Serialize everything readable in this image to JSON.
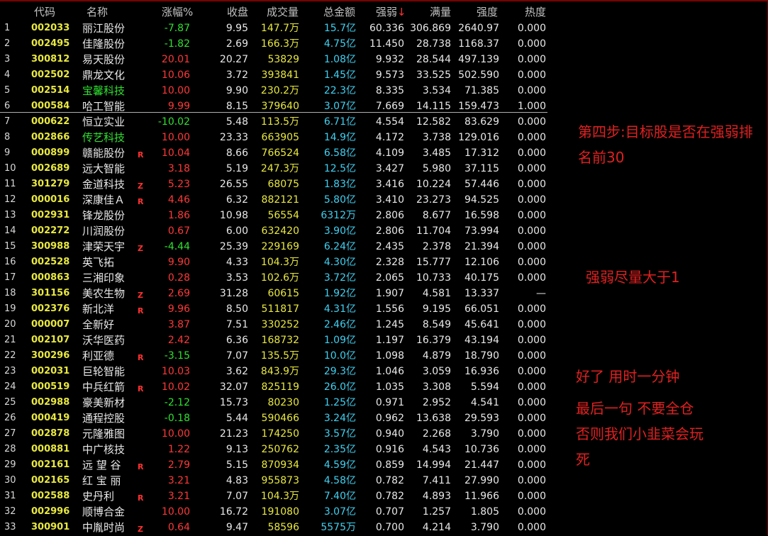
{
  "header": {
    "code": "代码",
    "name": "名称",
    "change": "涨幅%",
    "close": "收盘",
    "volume": "成交量",
    "amount": "总金额",
    "strength_weak": "强弱",
    "sort_arrow": "↓",
    "full": "满量",
    "strength": "强度",
    "heat": "热度"
  },
  "rows": [
    {
      "idx": "1",
      "code": "002033",
      "name": "丽江股份",
      "mark": "",
      "change": "-7.87",
      "close": "9.95",
      "volume": "147.7万",
      "amount": "15.7亿",
      "qr": "60.336",
      "mh": "306.869",
      "qd": "2640.97",
      "rd": "0.000"
    },
    {
      "idx": "2",
      "code": "002495",
      "name": "佳隆股份",
      "mark": "",
      "change": "-1.82",
      "close": "2.69",
      "volume": "166.3万",
      "amount": "4.75亿",
      "qr": "11.450",
      "mh": "28.738",
      "qd": "1168.37",
      "rd": "0.000"
    },
    {
      "idx": "3",
      "code": "300812",
      "name": "易天股份",
      "mark": "",
      "change": "20.01",
      "close": "20.27",
      "volume": "53829",
      "amount": "1.08亿",
      "qr": "9.932",
      "mh": "28.544",
      "qd": "497.139",
      "rd": "0.000"
    },
    {
      "idx": "4",
      "code": "002502",
      "name": "鼎龙文化",
      "mark": "",
      "change": "10.06",
      "close": "3.72",
      "volume": "393841",
      "amount": "1.45亿",
      "qr": "9.573",
      "mh": "33.525",
      "qd": "502.590",
      "rd": "0.000"
    },
    {
      "idx": "5",
      "code": "002514",
      "name": "宝馨科技",
      "mark": "",
      "change": "10.00",
      "close": "9.90",
      "volume": "230.2万",
      "amount": "22.3亿",
      "qr": "8.335",
      "mh": "3.534",
      "qd": "71.385",
      "rd": "0.000",
      "green_name": true
    },
    {
      "idx": "6",
      "code": "000584",
      "name": "哈工智能",
      "mark": "",
      "change": "9.99",
      "close": "8.15",
      "volume": "379640",
      "amount": "3.07亿",
      "qr": "7.669",
      "mh": "14.115",
      "qd": "159.473",
      "rd": "1.000"
    },
    {
      "idx": "7",
      "code": "000622",
      "name": "恒立实业",
      "mark": "",
      "change": "-10.02",
      "close": "5.48",
      "volume": "113.5万",
      "amount": "6.71亿",
      "qr": "4.554",
      "mh": "12.582",
      "qd": "83.629",
      "rd": "0.000"
    },
    {
      "idx": "8",
      "code": "002866",
      "name": "传艺科技",
      "mark": "",
      "change": "10.00",
      "close": "23.33",
      "volume": "663905",
      "amount": "14.9亿",
      "qr": "4.172",
      "mh": "3.738",
      "qd": "129.016",
      "rd": "0.000",
      "green_name": true
    },
    {
      "idx": "9",
      "code": "000899",
      "name": "赣能股份",
      "mark": "R",
      "change": "10.04",
      "close": "8.66",
      "volume": "766524",
      "amount": "6.58亿",
      "qr": "4.109",
      "mh": "3.485",
      "qd": "17.312",
      "rd": "0.000"
    },
    {
      "idx": "10",
      "code": "002689",
      "name": "远大智能",
      "mark": "",
      "change": "3.18",
      "close": "5.19",
      "volume": "247.3万",
      "amount": "12.5亿",
      "qr": "3.427",
      "mh": "5.980",
      "qd": "37.115",
      "rd": "0.000"
    },
    {
      "idx": "11",
      "code": "301279",
      "name": "金道科技",
      "mark": "Z",
      "change": "5.23",
      "close": "26.55",
      "volume": "68075",
      "amount": "1.83亿",
      "qr": "3.416",
      "mh": "10.224",
      "qd": "57.446",
      "rd": "0.000"
    },
    {
      "idx": "12",
      "code": "000016",
      "name": "深康佳Ａ",
      "mark": "R",
      "change": "4.46",
      "close": "6.32",
      "volume": "882121",
      "amount": "5.80亿",
      "qr": "3.410",
      "mh": "23.273",
      "qd": "94.525",
      "rd": "0.000"
    },
    {
      "idx": "13",
      "code": "002931",
      "name": "锋龙股份",
      "mark": "",
      "change": "1.86",
      "close": "10.98",
      "volume": "56554",
      "amount": "6312万",
      "qr": "2.806",
      "mh": "8.677",
      "qd": "16.598",
      "rd": "0.000"
    },
    {
      "idx": "14",
      "code": "002272",
      "name": "川润股份",
      "mark": "",
      "change": "0.67",
      "close": "6.00",
      "volume": "632420",
      "amount": "3.90亿",
      "qr": "2.806",
      "mh": "11.704",
      "qd": "73.994",
      "rd": "0.000"
    },
    {
      "idx": "15",
      "code": "300988",
      "name": "津荣天宇",
      "mark": "Z",
      "change": "-4.44",
      "close": "25.39",
      "volume": "229169",
      "amount": "6.24亿",
      "qr": "2.435",
      "mh": "2.378",
      "qd": "21.394",
      "rd": "0.000"
    },
    {
      "idx": "16",
      "code": "002528",
      "name": "英飞拓",
      "mark": "",
      "change": "9.90",
      "close": "4.33",
      "volume": "104.3万",
      "amount": "4.30亿",
      "qr": "2.328",
      "mh": "15.777",
      "qd": "12.106",
      "rd": "0.000"
    },
    {
      "idx": "17",
      "code": "000863",
      "name": "三湘印象",
      "mark": "",
      "change": "0.28",
      "close": "3.53",
      "volume": "102.6万",
      "amount": "3.72亿",
      "qr": "2.065",
      "mh": "10.733",
      "qd": "40.175",
      "rd": "0.000"
    },
    {
      "idx": "18",
      "code": "301156",
      "name": "美农生物",
      "mark": "Z",
      "change": "2.69",
      "close": "31.28",
      "volume": "60615",
      "amount": "1.92亿",
      "qr": "1.907",
      "mh": "4.581",
      "qd": "13.337",
      "rd": "—"
    },
    {
      "idx": "19",
      "code": "002376",
      "name": "新北洋",
      "mark": "R",
      "change": "9.96",
      "close": "8.50",
      "volume": "511817",
      "amount": "4.31亿",
      "qr": "1.556",
      "mh": "9.195",
      "qd": "66.051",
      "rd": "0.000"
    },
    {
      "idx": "20",
      "code": "000007",
      "name": "全新好",
      "mark": "",
      "change": "3.87",
      "close": "7.51",
      "volume": "330252",
      "amount": "2.46亿",
      "qr": "1.245",
      "mh": "8.549",
      "qd": "45.641",
      "rd": "0.000"
    },
    {
      "idx": "21",
      "code": "002107",
      "name": "沃华医药",
      "mark": "",
      "change": "2.42",
      "close": "6.36",
      "volume": "168732",
      "amount": "1.09亿",
      "qr": "1.197",
      "mh": "16.379",
      "qd": "43.194",
      "rd": "0.000"
    },
    {
      "idx": "22",
      "code": "300296",
      "name": "利亚德",
      "mark": "R",
      "change": "-3.15",
      "close": "7.07",
      "volume": "135.5万",
      "amount": "10.0亿",
      "qr": "1.098",
      "mh": "4.879",
      "qd": "18.790",
      "rd": "0.000"
    },
    {
      "idx": "23",
      "code": "002031",
      "name": "巨轮智能",
      "mark": "",
      "change": "10.03",
      "close": "3.62",
      "volume": "843.9万",
      "amount": "29.3亿",
      "qr": "1.046",
      "mh": "3.059",
      "qd": "16.936",
      "rd": "0.000"
    },
    {
      "idx": "24",
      "code": "000519",
      "name": "中兵红箭",
      "mark": "R",
      "change": "10.02",
      "close": "32.07",
      "volume": "825119",
      "amount": "26.0亿",
      "qr": "1.035",
      "mh": "3.308",
      "qd": "5.594",
      "rd": "0.000"
    },
    {
      "idx": "25",
      "code": "002988",
      "name": "豪美新材",
      "mark": "",
      "change": "-2.12",
      "close": "15.73",
      "volume": "80230",
      "amount": "1.25亿",
      "qr": "0.971",
      "mh": "2.952",
      "qd": "4.541",
      "rd": "0.000"
    },
    {
      "idx": "26",
      "code": "000419",
      "name": "通程控股",
      "mark": "",
      "change": "-0.18",
      "close": "5.44",
      "volume": "590466",
      "amount": "3.24亿",
      "qr": "0.962",
      "mh": "13.638",
      "qd": "29.593",
      "rd": "0.000"
    },
    {
      "idx": "27",
      "code": "002878",
      "name": "元隆雅图",
      "mark": "",
      "change": "10.00",
      "close": "21.23",
      "volume": "174250",
      "amount": "3.57亿",
      "qr": "0.940",
      "mh": "2.268",
      "qd": "3.790",
      "rd": "0.000"
    },
    {
      "idx": "28",
      "code": "000881",
      "name": "中广核技",
      "mark": "",
      "change": "1.22",
      "close": "9.13",
      "volume": "250762",
      "amount": "2.35亿",
      "qr": "0.916",
      "mh": "4.543",
      "qd": "10.736",
      "rd": "0.000"
    },
    {
      "idx": "29",
      "code": "002161",
      "name": "远 望 谷",
      "mark": "R",
      "change": "2.79",
      "close": "5.15",
      "volume": "870934",
      "amount": "4.59亿",
      "qr": "0.859",
      "mh": "14.994",
      "qd": "21.447",
      "rd": "0.000"
    },
    {
      "idx": "30",
      "code": "002165",
      "name": "红 宝 丽",
      "mark": "",
      "change": "3.21",
      "close": "4.83",
      "volume": "955873",
      "amount": "4.58亿",
      "qr": "0.782",
      "mh": "7.411",
      "qd": "27.990",
      "rd": "0.000"
    },
    {
      "idx": "31",
      "code": "002588",
      "name": "史丹利",
      "mark": "R",
      "change": "3.21",
      "close": "7.07",
      "volume": "104.3万",
      "amount": "7.40亿",
      "qr": "0.782",
      "mh": "4.893",
      "qd": "11.966",
      "rd": "0.000"
    },
    {
      "idx": "32",
      "code": "002996",
      "name": "顺博合金",
      "mark": "",
      "change": "10.00",
      "close": "16.72",
      "volume": "191080",
      "amount": "3.07亿",
      "qr": "0.707",
      "mh": "1.257",
      "qd": "1.805",
      "rd": "0.000"
    },
    {
      "idx": "33",
      "code": "300901",
      "name": "中胤时尚",
      "mark": "Z",
      "change": "0.64",
      "close": "9.47",
      "volume": "58596",
      "amount": "5575万",
      "qr": "0.700",
      "mh": "4.214",
      "qd": "3.790",
      "rd": "0.000"
    }
  ],
  "notes": {
    "step4_line1": "第四步:目标股是否在强弱排",
    "step4_line2": "名前30",
    "tip": "强弱尽量大于1",
    "done": "好了   用时一分钟",
    "last_line1": "最后一句     不要全仓",
    "last_line2": "否则我们小韭菜会玩",
    "last_line3": "死"
  },
  "colors": {
    "background": "#000000",
    "up": "#ff3838",
    "down": "#30e030",
    "code": "#e8e840",
    "amount": "#40d0f0",
    "annotation": "#e02020"
  }
}
